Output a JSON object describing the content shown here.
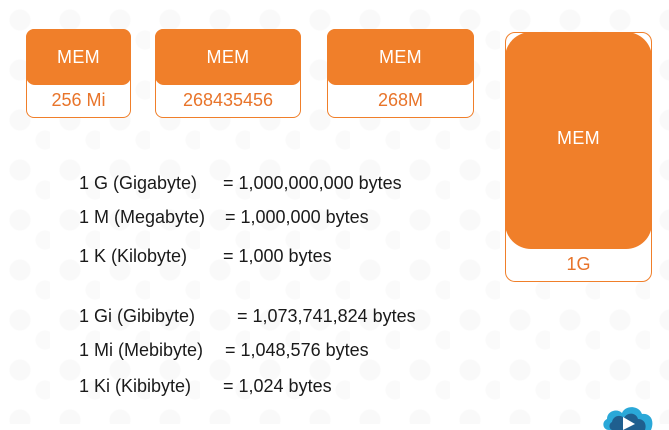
{
  "cards": [
    {
      "header": "MEM",
      "value": "256 Mi"
    },
    {
      "header": "MEM",
      "value": "268435456"
    },
    {
      "header": "MEM",
      "value": "268M"
    },
    {
      "header": "MEM",
      "value": "1G"
    }
  ],
  "decimal_units": [
    {
      "name": "1 G (Gigabyte)",
      "value": "= 1,000,000,000 bytes"
    },
    {
      "name": "1 M (Megabyte)",
      "value": "= 1,000,000 bytes"
    },
    {
      "name": "1 K (Kilobyte)",
      "value": "= 1,000 bytes"
    }
  ],
  "binary_units": [
    {
      "name": "1 Gi (Gibibyte)",
      "value": "= 1,073,741,824 bytes"
    },
    {
      "name": "1 Mi (Mebibyte)",
      "value": "= 1,048,576 bytes"
    },
    {
      "name": "1 Ki (Kibibyte)",
      "value": "= 1,024 bytes"
    }
  ],
  "colors": {
    "accent": "#f07f2a",
    "value_text": "#e8742a",
    "body_text": "#1a1a1a"
  }
}
